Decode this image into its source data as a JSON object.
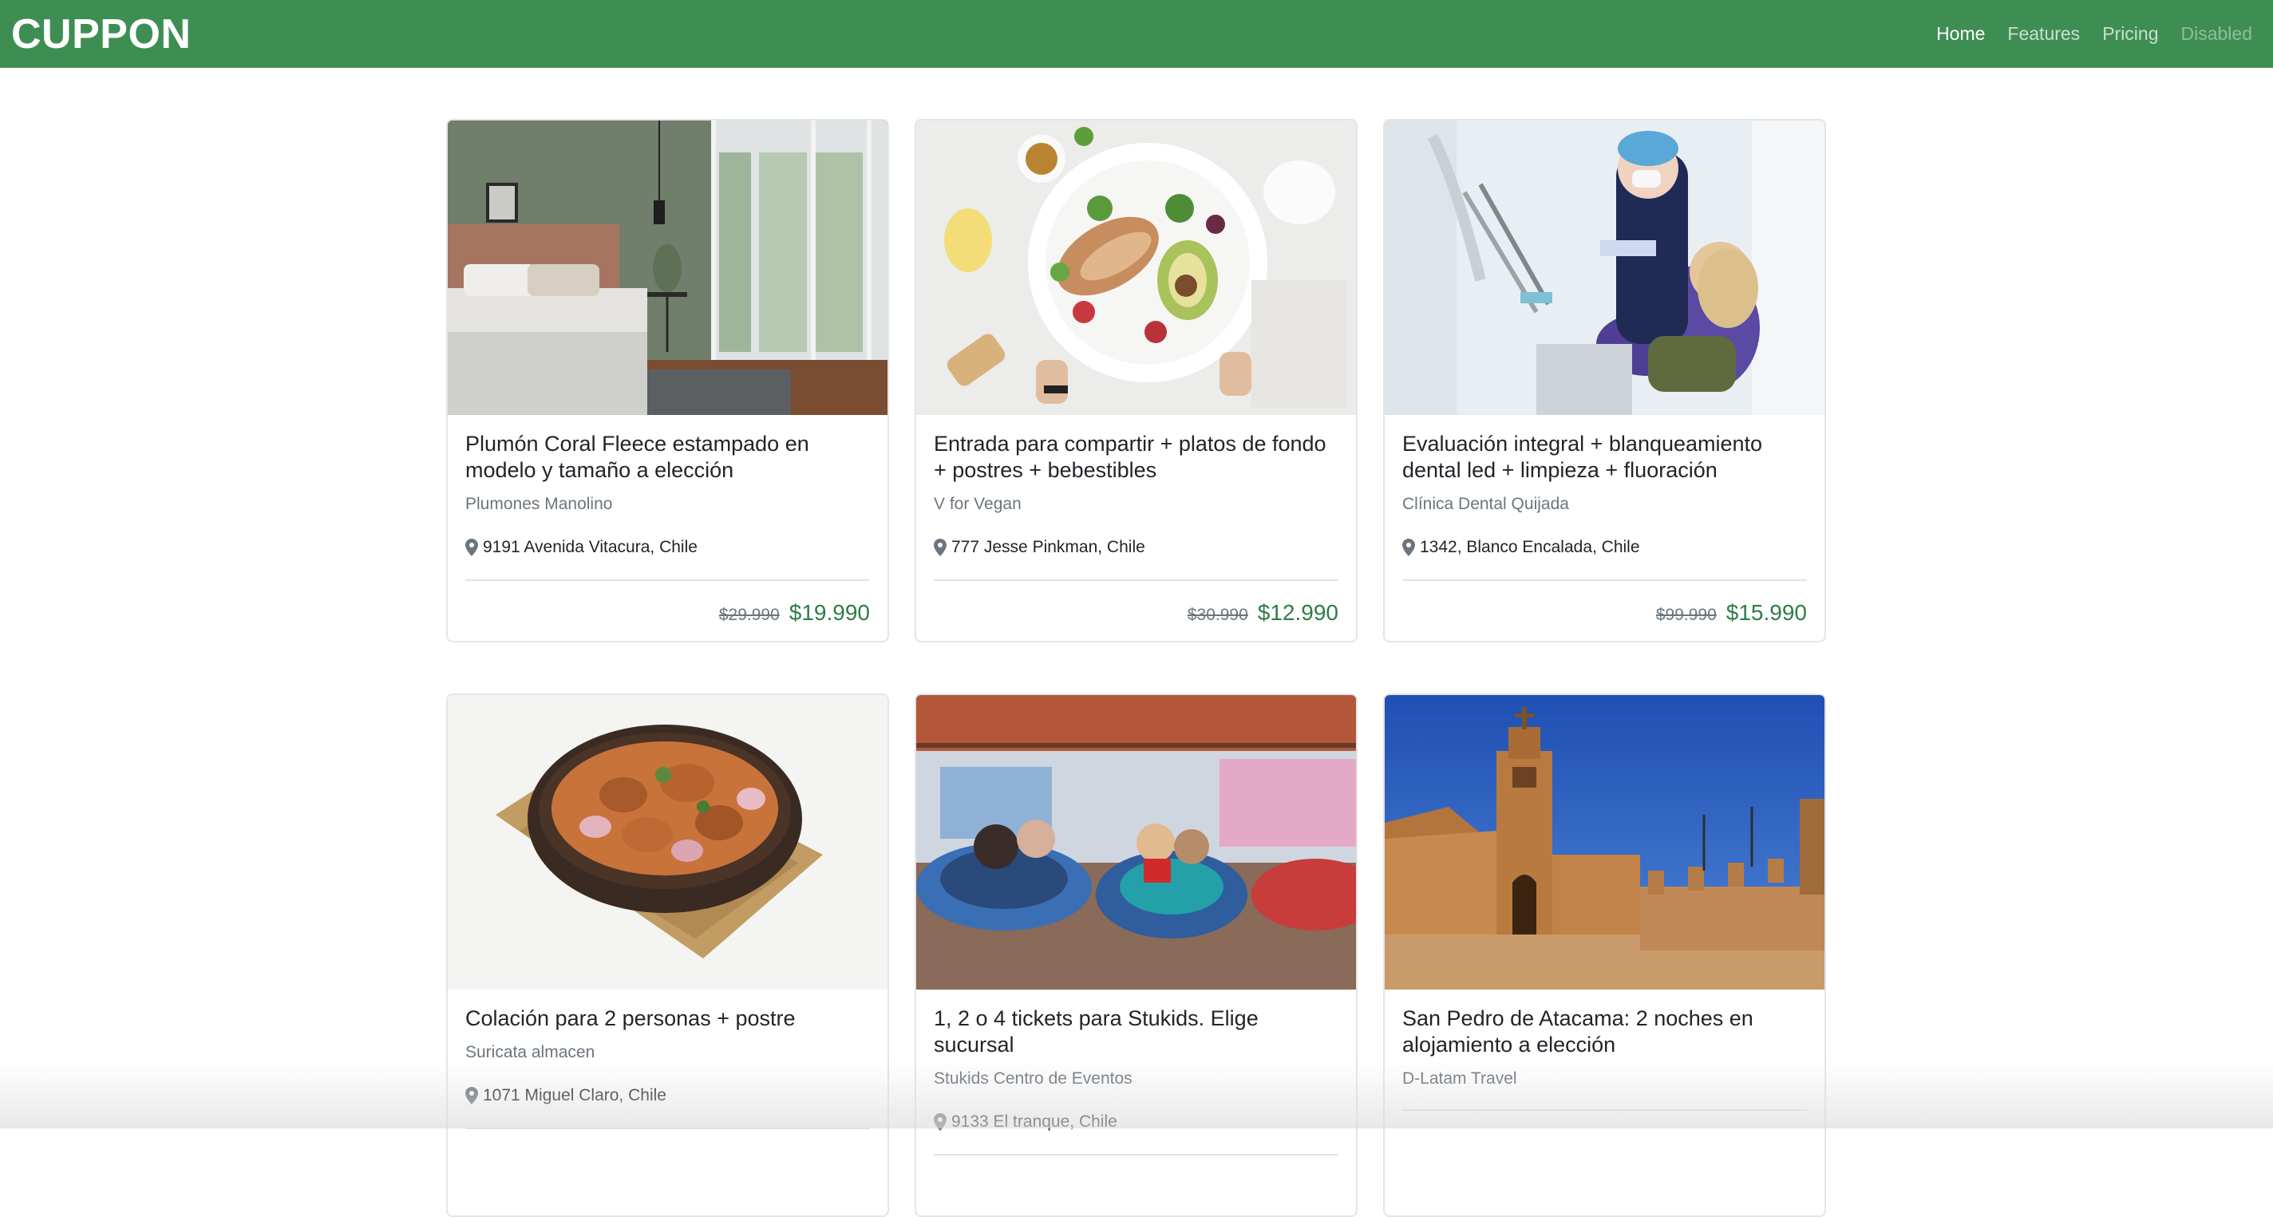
{
  "navbar": {
    "brand": "CUPPON",
    "links": [
      {
        "label": "Home",
        "state": "active"
      },
      {
        "label": "Features",
        "state": "normal"
      },
      {
        "label": "Pricing",
        "state": "normal"
      },
      {
        "label": "Disabled",
        "state": "disabled"
      }
    ],
    "background_color": "#3e8e53"
  },
  "cards": [
    {
      "image_icon": "bedroom-photo",
      "title": "Plumón Coral Fleece estampado en modelo y tamaño a elección",
      "merchant": "Plumones Manolino",
      "location": "9191 Avenida Vitacura, Chile",
      "old_price": "$29.990",
      "price": "$19.990"
    },
    {
      "image_icon": "salad-bowl-photo",
      "title": "Entrada para compartir + platos de fondo + postres + bebestibles",
      "merchant": "V for Vegan",
      "location": "777 Jesse Pinkman, Chile",
      "old_price": "$30.990",
      "price": "$12.990"
    },
    {
      "image_icon": "dentist-photo",
      "title": "Evaluación integral + blanqueamiento dental led + limpieza + fluoración",
      "merchant": "Clínica Dental Quijada",
      "location": "1342, Blanco Encalada, Chile",
      "old_price": "$99.990",
      "price": "$15.990"
    },
    {
      "image_icon": "curry-bowl-photo",
      "title": "Colación para 2 personas + postre",
      "merchant": "Suricata almacen",
      "location": "1071 Miguel Claro, Chile"
    },
    {
      "image_icon": "bumper-cars-photo",
      "title": "1, 2 o 4 tickets para Stukids. Elige sucursal",
      "merchant": "Stukids Centro de Eventos",
      "location": "9133 El tranque, Chile"
    },
    {
      "image_icon": "adobe-church-photo",
      "title": "San Pedro de Atacama: 2 noches en alojamiento a elección",
      "merchant": "D-Latam Travel"
    }
  ],
  "colors": {
    "price": "#2e7d45",
    "muted": "#6c757d"
  }
}
